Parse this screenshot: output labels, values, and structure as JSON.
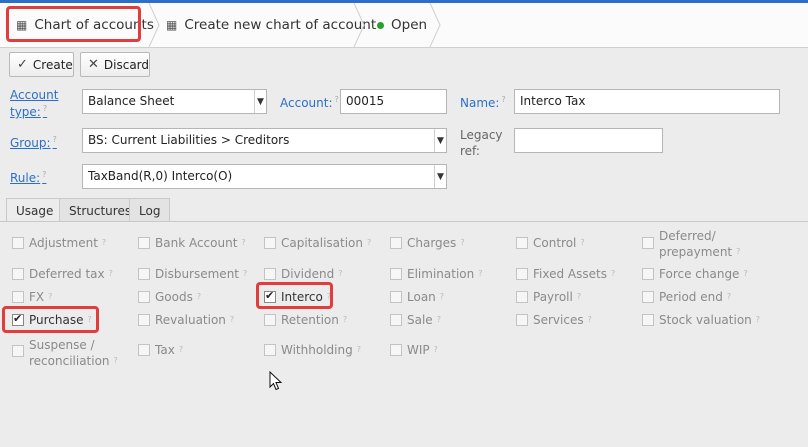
{
  "breadcrumb": [
    {
      "label": "Chart of accounts"
    },
    {
      "label": "Create new chart of account"
    },
    {
      "label": "Open"
    }
  ],
  "toolbar": {
    "create": "Create",
    "discard": "Discard"
  },
  "form": {
    "account_type_label": "Account type:",
    "account_type_value": "Balance Sheet",
    "account_label": "Account:",
    "account_value": "00015",
    "name_label": "Name:",
    "name_value": "Interco Tax",
    "group_label": "Group:",
    "group_value": "BS: Current Liabilities > Creditors",
    "legacy_label": "Legacy ref:",
    "legacy_value": "",
    "rule_label": "Rule:",
    "rule_value": "TaxBand(R,0) Interco(O)",
    "help": "?"
  },
  "tabs": [
    "Usage",
    "Structures",
    "Log"
  ],
  "usage": [
    {
      "label": "Adjustment",
      "checked": false
    },
    {
      "label": "Bank Account",
      "checked": false
    },
    {
      "label": "Capitalisation",
      "checked": false
    },
    {
      "label": "Charges",
      "checked": false
    },
    {
      "label": "Control",
      "checked": false
    },
    {
      "label": "Deferred/ prepayment",
      "checked": false
    },
    {
      "label": "Deferred tax",
      "checked": false
    },
    {
      "label": "Disbursement",
      "checked": false
    },
    {
      "label": "Dividend",
      "checked": false
    },
    {
      "label": "Elimination",
      "checked": false
    },
    {
      "label": "Fixed Assets",
      "checked": false
    },
    {
      "label": "Force change",
      "checked": false
    },
    {
      "label": "FX",
      "checked": false
    },
    {
      "label": "Goods",
      "checked": false
    },
    {
      "label": "Interco",
      "checked": true
    },
    {
      "label": "Loan",
      "checked": false
    },
    {
      "label": "Payroll",
      "checked": false
    },
    {
      "label": "Period end",
      "checked": false
    },
    {
      "label": "Purchase",
      "checked": true
    },
    {
      "label": "Revaluation",
      "checked": false
    },
    {
      "label": "Retention",
      "checked": false
    },
    {
      "label": "Sale",
      "checked": false
    },
    {
      "label": "Services",
      "checked": false
    },
    {
      "label": "Stock valuation",
      "checked": false
    },
    {
      "label": "Suspense / reconciliation",
      "checked": false
    },
    {
      "label": "Tax",
      "checked": false
    },
    {
      "label": "Withholding",
      "checked": false
    },
    {
      "label": "WIP",
      "checked": false
    }
  ],
  "colors": {
    "accent": "#2b6fc9",
    "highlight": "#e23d3d",
    "status_open": "#2aa02a"
  }
}
